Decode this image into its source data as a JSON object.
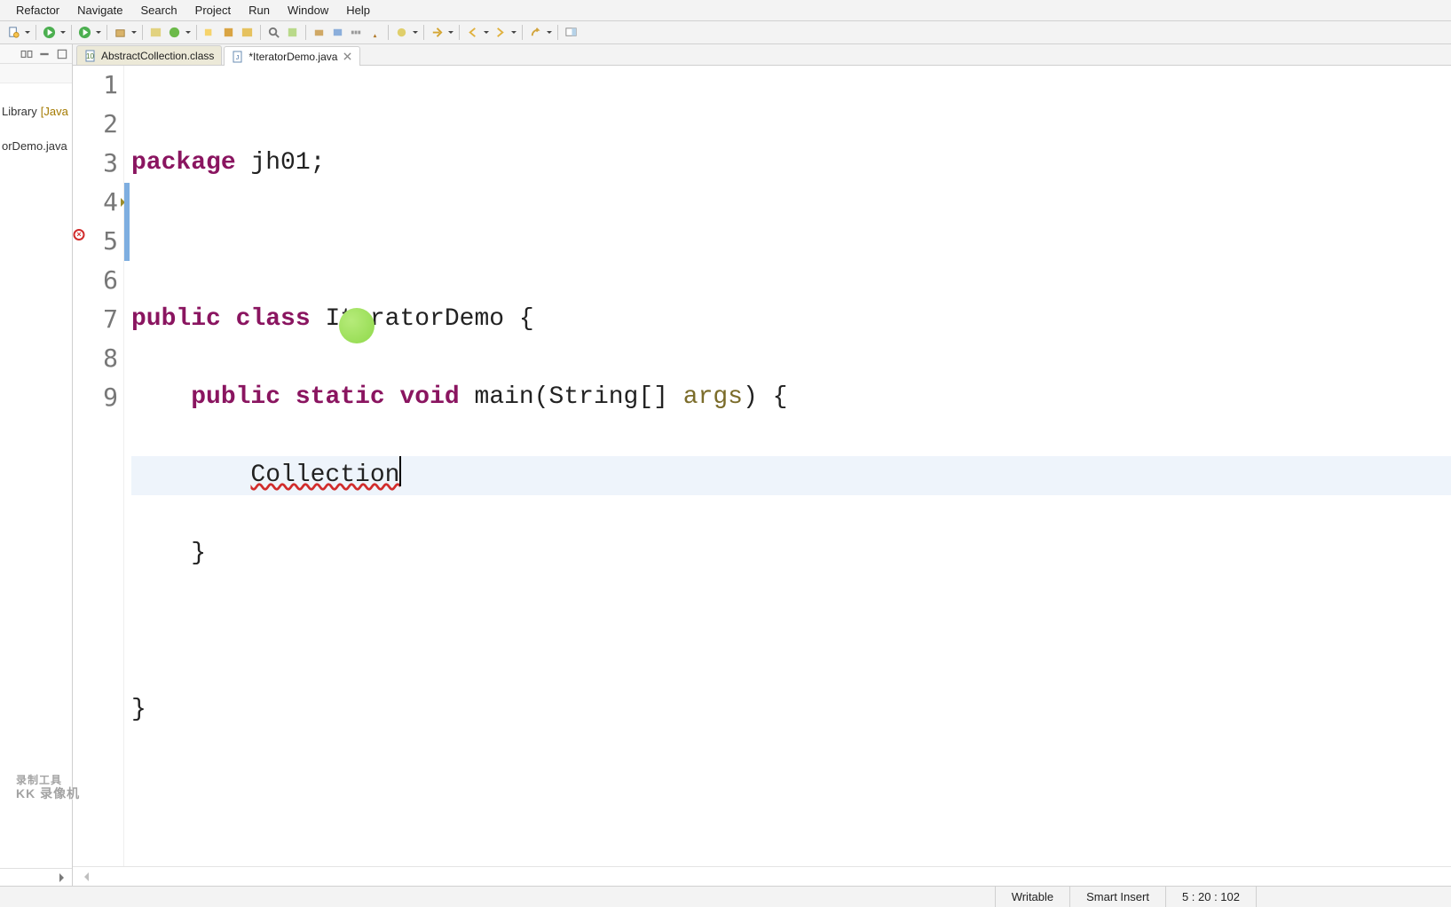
{
  "menu": {
    "refactor": "Refactor",
    "navigate": "Navigate",
    "search": "Search",
    "project": "Project",
    "run": "Run",
    "window": "Window",
    "help": "Help"
  },
  "left_panel": {
    "item_library": "Library",
    "item_library_deco": "[Java",
    "item_file": "orDemo.java"
  },
  "tabs": {
    "tab1": "AbstractCollection.class",
    "tab2": "*IteratorDemo.java"
  },
  "code": {
    "line_numbers": [
      "1",
      "2",
      "3",
      "4",
      "5",
      "6",
      "7",
      "8",
      "9"
    ],
    "l1_kw": "package",
    "l1_rest": " jh01;",
    "l3_kw1": "public",
    "l3_kw2": "class",
    "l3_name": " IteratorDemo {",
    "l4_kw1": "public",
    "l4_kw2": "static",
    "l4_kw3": "void",
    "l4_mid": " main(String[] ",
    "l4_param": "args",
    "l4_end": ") {",
    "l5_indent": "        ",
    "l5_err": "Collection",
    "l6": "    }",
    "l8": "}"
  },
  "status": {
    "writable": "Writable",
    "insert": "Smart Insert",
    "position": "5 : 20 : 102"
  },
  "watermark": {
    "line1": "录制工具",
    "line2": "KK 录像机"
  }
}
